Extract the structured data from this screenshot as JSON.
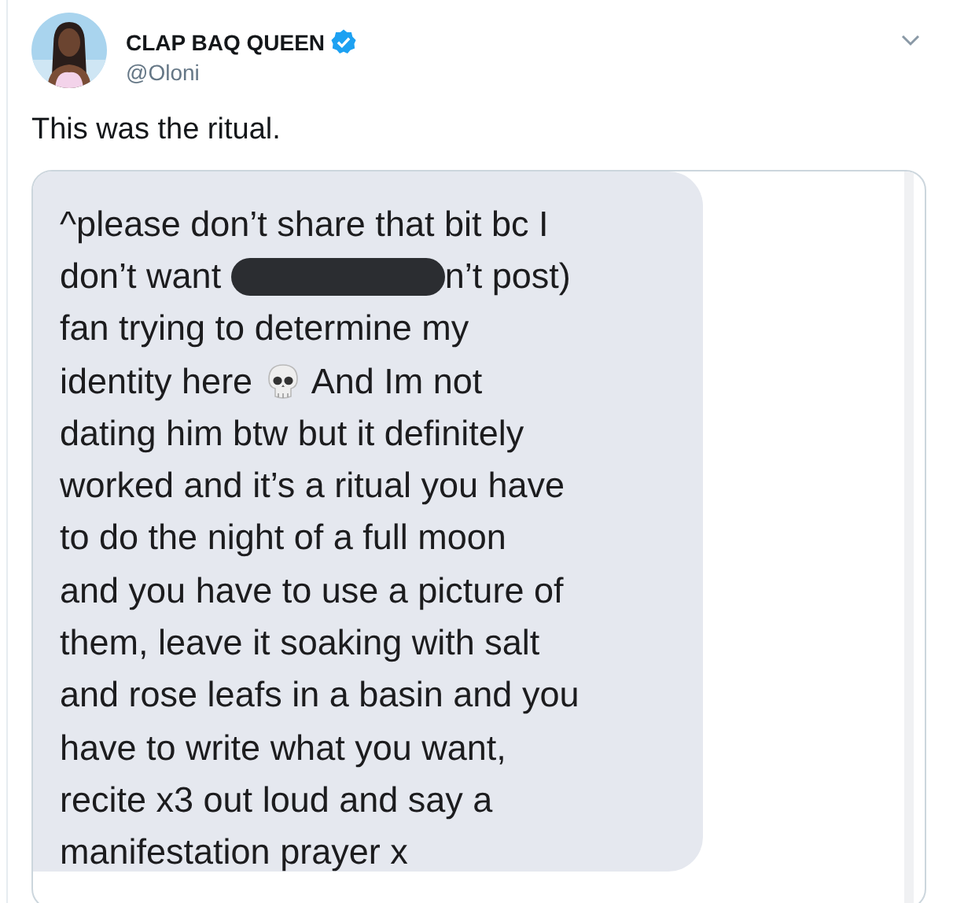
{
  "tweet": {
    "author": {
      "name": "CLAP BAQ QUEEN",
      "verified": true,
      "handle": "@Oloni"
    },
    "text": "This was the ritual.",
    "attachment": {
      "kind": "message_screenshot",
      "lines": [
        [
          {
            "kind": "text",
            "text": "^please don’t share that bit bc I"
          }
        ],
        [
          {
            "kind": "text",
            "text": "don’t want "
          },
          {
            "kind": "redaction"
          },
          {
            "kind": "text",
            "text": "n’t post)"
          }
        ],
        [
          {
            "kind": "text",
            "text": "fan trying to determine my"
          }
        ],
        [
          {
            "kind": "text",
            "text": "identity here "
          },
          {
            "kind": "skull"
          },
          {
            "kind": "text",
            "text": " And Im not"
          }
        ],
        [
          {
            "kind": "text",
            "text": "dating him btw but it definitely"
          }
        ],
        [
          {
            "kind": "text",
            "text": "worked and it’s a ritual you have"
          }
        ],
        [
          {
            "kind": "text",
            "text": "to do the night of a full moon"
          }
        ],
        [
          {
            "kind": "text",
            "text": "and you have to use a picture of"
          }
        ],
        [
          {
            "kind": "text",
            "text": "them, leave it soaking with salt"
          }
        ],
        [
          {
            "kind": "text",
            "text": "and rose leafs in a basin and you"
          }
        ],
        [
          {
            "kind": "text",
            "text": "have to write what you want,"
          }
        ],
        [
          {
            "kind": "text",
            "text": "recite x3 out loud and say a"
          }
        ],
        [
          {
            "kind": "text",
            "text": "manifestation prayer x"
          }
        ]
      ]
    }
  }
}
